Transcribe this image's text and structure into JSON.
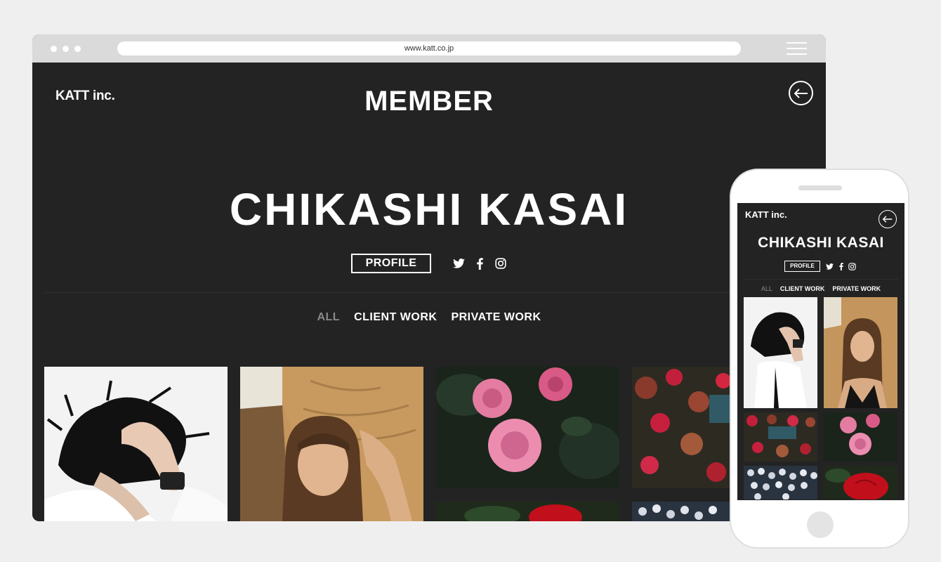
{
  "browser": {
    "url": "www.katt.co.jp",
    "menu_icon": "hamburger-menu-icon"
  },
  "site": {
    "logo": "KATT inc.",
    "page_title": "MEMBER",
    "back_icon": "arrow-left-circle-icon",
    "member_name": "CHIKASHI KASAI",
    "profile_label": "PROFILE",
    "social_icons": [
      "twitter-icon",
      "facebook-icon",
      "instagram-icon"
    ],
    "filters": [
      {
        "label": "ALL",
        "active": false
      },
      {
        "label": "CLIENT WORK",
        "active": true
      },
      {
        "label": "PRIVATE WORK",
        "active": true
      }
    ],
    "gallery": [
      {
        "name": "photo-man-hand-in-hair",
        "color": "#f2f2f2"
      },
      {
        "name": "photo-woman-rock-wall",
        "color": "#b98a55"
      },
      {
        "name": "photo-pink-roses",
        "color": "#1d2a1e"
      },
      {
        "name": "photo-red-flowers",
        "color": "#3a2420"
      },
      {
        "name": "photo-red-rose",
        "color": "#1f2a1c"
      },
      {
        "name": "photo-white-flowers",
        "color": "#c9ccd3"
      }
    ]
  },
  "mobile": {
    "logo": "KATT inc.",
    "member_name": "CHIKASHI KASAI",
    "profile_label": "PROFILE",
    "filters": [
      {
        "label": "ALL",
        "active": false
      },
      {
        "label": "CLIENT WORK",
        "active": true
      },
      {
        "label": "PRIVATE WORK",
        "active": true
      }
    ]
  },
  "colors": {
    "background": "#efefef",
    "site_background": "#232323",
    "browser_bar": "#dadada",
    "inactive_text": "#8a8a8a"
  }
}
